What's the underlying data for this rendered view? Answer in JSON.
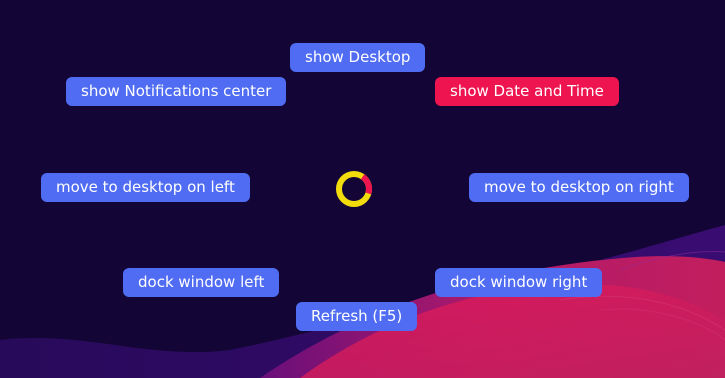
{
  "menu": {
    "show_desktop": "show Desktop",
    "show_notifications": "show Notifications center",
    "show_date_time": "show Date and Time",
    "move_left": "move to desktop on left",
    "move_right": "move to desktop on right",
    "dock_left": "dock window left",
    "dock_right": "dock window right",
    "refresh": "Refresh (F5)"
  },
  "colors": {
    "background": "#130535",
    "button": "#4f6cf2",
    "button_active": "#ee1450",
    "hub_ring": "#f2dc0c",
    "hub_segment": "#ee1450"
  },
  "hub": {
    "icon": "radial-menu-hub-icon"
  }
}
